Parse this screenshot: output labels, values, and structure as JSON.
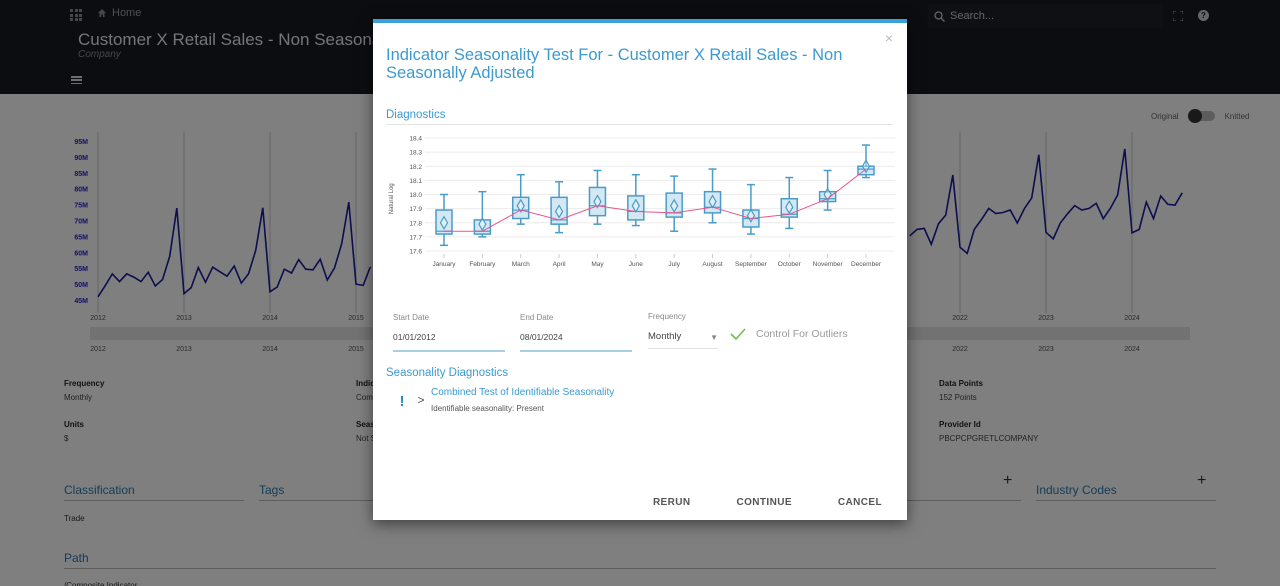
{
  "header": {
    "home_label": "Home",
    "title": "Customer X Retail Sales - Non Seasonally Adjusted",
    "subtitle": "Company",
    "search_placeholder": "Search...",
    "help_label": "?"
  },
  "view_toggle": {
    "left_label": "Original",
    "right_label": "Knitted",
    "state": "Original"
  },
  "background_chart": {
    "type": "line",
    "y_ticks": [
      "95M",
      "90M",
      "85M",
      "80M",
      "75M",
      "70M",
      "65M",
      "60M",
      "55M",
      "50M",
      "45M"
    ],
    "x_ticks": [
      "2012",
      "2013",
      "2014",
      "2015",
      "2022",
      "2023",
      "2024"
    ],
    "navigator_ticks": [
      "2012",
      "2013",
      "2014",
      "2015",
      "2022",
      "2023",
      "2024"
    ],
    "color": "#1a1aa0",
    "series_2012_2015_M": [
      46,
      49.5,
      53.2,
      50.8,
      53.2,
      52.2,
      50.8,
      53.7,
      49.4,
      51.4,
      58.7,
      73.9,
      47.0,
      48.9,
      55.2,
      50.6,
      55.3,
      53.9,
      52.5,
      55.7,
      50.3,
      53.2,
      60.6,
      74.0,
      47.6,
      49.1,
      54.7,
      53.5,
      57.7,
      54.7,
      54.5,
      57.8,
      51.3,
      55.1,
      62.7,
      75.8,
      50.0,
      49.6,
      55.4
    ],
    "series_jun2021_aug2024_M": [
      65.2,
      67.2,
      67.5,
      62.5,
      69.0,
      71.7,
      84.3,
      61.6,
      59.7,
      67.2,
      70.3,
      73.8,
      72.2,
      72.5,
      73.3,
      69.2,
      73.8,
      77.1,
      90.7,
      66.3,
      64.2,
      69.2,
      72.1,
      74.7,
      73.3,
      73.8,
      75.4,
      70.6,
      73.9,
      78.1,
      92.5,
      66.1,
      67.2,
      75.8,
      70.6,
      77.7,
      75.1,
      74.8,
      78.7
    ]
  },
  "metadata": {
    "frequency": {
      "label": "Frequency",
      "value": "Monthly"
    },
    "units": {
      "label": "Units",
      "value": "$"
    },
    "indicator_partial": {
      "label": "Indic",
      "value": "Com"
    },
    "seasonal_partial": {
      "label": "Seas",
      "value": "Not S"
    },
    "data_points": {
      "label": "Data Points",
      "value": "152 Points"
    },
    "provider_id": {
      "label": "Provider Id",
      "value": "PBCPCPGRETLCOMPANY"
    }
  },
  "sections": {
    "classification": {
      "title": "Classification",
      "value": "Trade"
    },
    "tags": {
      "title": "Tags"
    },
    "industry_codes": {
      "title": "Industry Codes"
    },
    "path": {
      "title": "Path",
      "value": "/Composite Indicator"
    },
    "plus": "+"
  },
  "modal": {
    "close_label": "×",
    "title": "Indicator Seasonality Test For - Customer X Retail Sales - Non Seasonally Adjusted",
    "diagnostics_heading": "Diagnostics",
    "start_date": {
      "label": "Start Date",
      "value": "01/01/2012"
    },
    "end_date": {
      "label": "End Date",
      "value": "08/01/2024"
    },
    "frequency": {
      "label": "Frequency",
      "value": "Monthly"
    },
    "control_outliers": {
      "label": "Control For Outliers",
      "checked": true
    },
    "seasonality_heading": "Seasonality Diagnostics",
    "test": {
      "title": "Combined Test of Identifiable Seasonality",
      "result": "Identifiable seasonality: Present",
      "status_icon": "!"
    },
    "buttons": {
      "rerun": "RERUN",
      "continue": "CONTINUE",
      "cancel": "CANCEL"
    }
  },
  "chart_data": {
    "type": "box",
    "title": "",
    "xlabel": "",
    "ylabel": "Natural Log",
    "ylim": [
      17.6,
      18.4
    ],
    "y_ticks": [
      "18.4",
      "18.3",
      "18.2",
      "18.1",
      "18.0",
      "17.9",
      "17.8",
      "17.7",
      "17.6"
    ],
    "grid": true,
    "categories": [
      "January",
      "February",
      "March",
      "April",
      "May",
      "June",
      "July",
      "August",
      "September",
      "October",
      "November",
      "December"
    ],
    "series": [
      {
        "name": "whisker_high",
        "values": [
          18.0,
          18.02,
          18.14,
          18.09,
          18.17,
          18.14,
          18.13,
          18.18,
          18.07,
          18.12,
          18.17,
          18.35
        ]
      },
      {
        "name": "q3",
        "values": [
          17.89,
          17.82,
          17.98,
          17.98,
          18.05,
          17.99,
          18.01,
          18.02,
          17.89,
          17.97,
          18.02,
          18.2
        ]
      },
      {
        "name": "median",
        "values": [
          17.74,
          17.74,
          17.89,
          17.82,
          17.92,
          17.88,
          17.87,
          17.91,
          17.83,
          17.86,
          17.97,
          18.18
        ]
      },
      {
        "name": "q1",
        "values": [
          17.72,
          17.72,
          17.83,
          17.79,
          17.85,
          17.82,
          17.84,
          17.87,
          17.77,
          17.84,
          17.95,
          18.14
        ]
      },
      {
        "name": "whisker_low",
        "values": [
          17.64,
          17.7,
          17.79,
          17.73,
          17.79,
          17.78,
          17.74,
          17.8,
          17.72,
          17.76,
          17.89,
          18.12
        ]
      },
      {
        "name": "mean",
        "values": [
          17.8,
          17.79,
          17.92,
          17.88,
          17.95,
          17.92,
          17.92,
          17.95,
          17.85,
          17.91,
          18.0,
          18.2
        ]
      }
    ],
    "median_line_color": "#e8558a",
    "box_color": "#4a9cc8",
    "box_fill": "#d4e8f4"
  }
}
